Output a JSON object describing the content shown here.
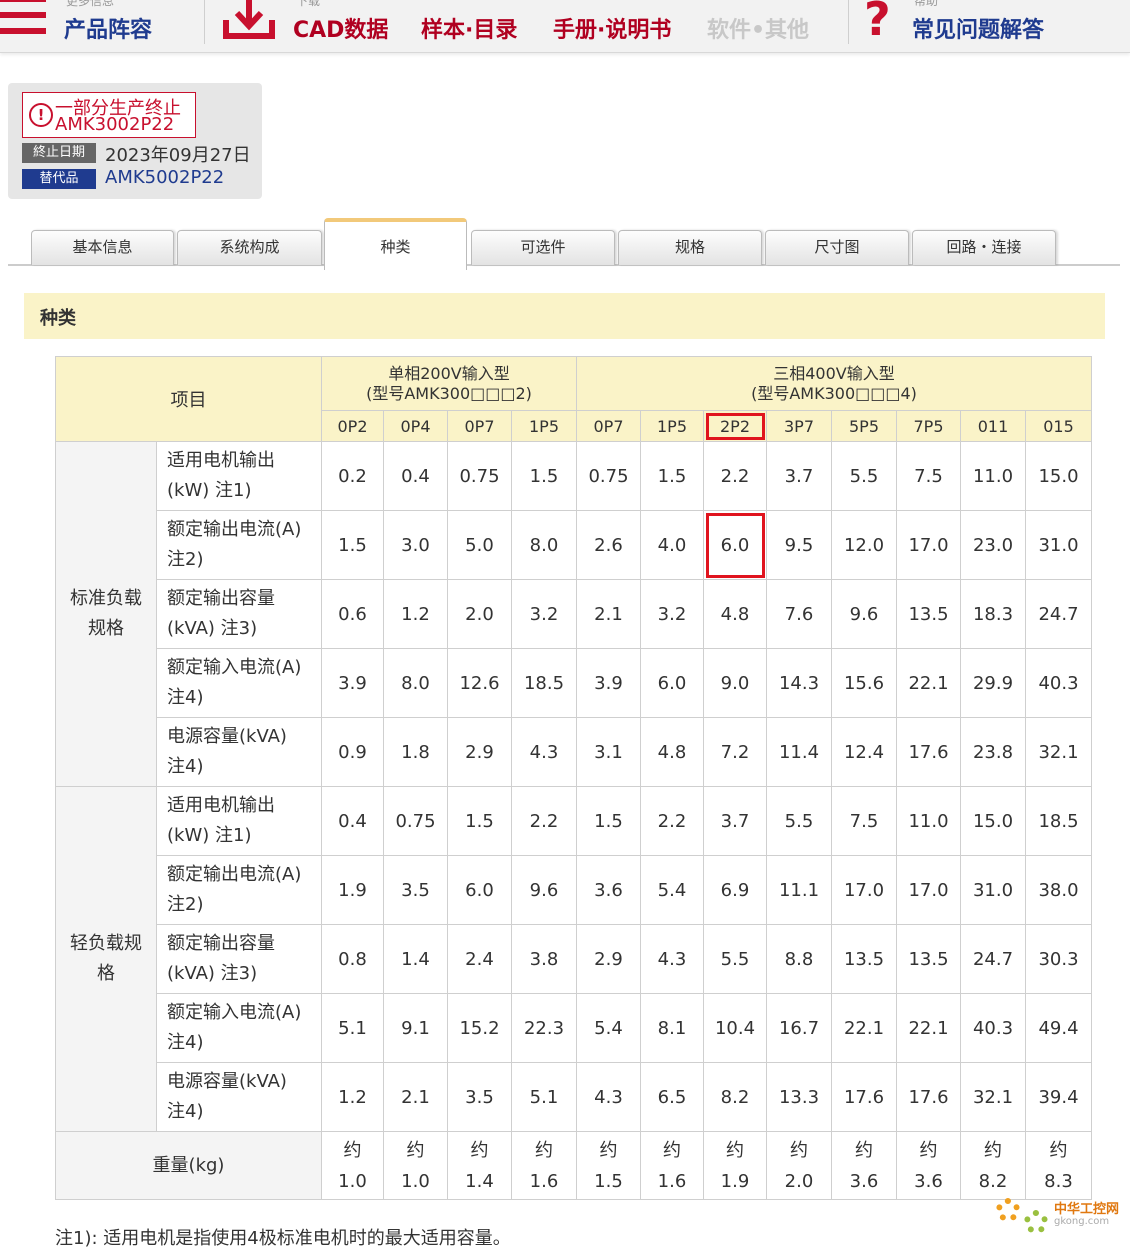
{
  "nav": {
    "small_1": "更多信息",
    "item_1": "产品阵容",
    "small_2": "下载",
    "item_2": "CAD数据",
    "item_3": "样本·目录",
    "item_4": "手册·说明书",
    "item_5": "软件•其他",
    "small_3": "帮助",
    "item_6": "常见问题解答",
    "accent_color": "#c8102e",
    "link_color": "#1f3b8f"
  },
  "status": {
    "title": "一部分生产终止",
    "model": "AMK3002P22",
    "end_label": "終止日期",
    "end_date": "2023年09月27日",
    "replacement_label": "替代品",
    "replacement": "AMK5002P22"
  },
  "tabs": [
    "基本信息",
    "系统构成",
    "种类",
    "可选件",
    "规格",
    "尺寸图",
    "回路・连接"
  ],
  "active_tab": "种类",
  "section_title": "种类",
  "table": {
    "item_header": "项目",
    "group_single_line1": "单相200V输入型",
    "group_single_line2": "(型号AMK300□□□2)",
    "group_three_line1": "三相400V输入型",
    "group_three_line2": "(型号AMK300□□□4)",
    "models": [
      "0P2",
      "0P4",
      "0P7",
      "1P5",
      "0P7",
      "1P5",
      "2P2",
      "3P7",
      "5P5",
      "7P5",
      "011",
      "015"
    ],
    "highlighted_model": "2P2",
    "sections": [
      {
        "name_line1": "标准负载",
        "name_line2": "规格",
        "rows": [
          {
            "label_line1": "适用电机输出",
            "label_line2": "(kW) 注1)",
            "values": [
              "0.2",
              "0.4",
              "0.75",
              "1.5",
              "0.75",
              "1.5",
              "2.2",
              "3.7",
              "5.5",
              "7.5",
              "11.0",
              "15.0"
            ]
          },
          {
            "label_line1": "额定输出电流(A)",
            "label_line2": "注2)",
            "values": [
              "1.5",
              "3.0",
              "5.0",
              "8.0",
              "2.6",
              "4.0",
              "6.0",
              "9.5",
              "12.0",
              "17.0",
              "23.0",
              "31.0"
            ]
          },
          {
            "label_line1": "额定输出容量",
            "label_line2": "(kVA) 注3)",
            "values": [
              "0.6",
              "1.2",
              "2.0",
              "3.2",
              "2.1",
              "3.2",
              "4.8",
              "7.6",
              "9.6",
              "13.5",
              "18.3",
              "24.7"
            ]
          },
          {
            "label_line1": "额定输入电流(A)",
            "label_line2": "注4)",
            "values": [
              "3.9",
              "8.0",
              "12.6",
              "18.5",
              "3.9",
              "6.0",
              "9.0",
              "14.3",
              "15.6",
              "22.1",
              "29.9",
              "40.3"
            ]
          },
          {
            "label_line1": "电源容量(kVA)",
            "label_line2": "注4)",
            "values": [
              "0.9",
              "1.8",
              "2.9",
              "4.3",
              "3.1",
              "4.8",
              "7.2",
              "11.4",
              "12.4",
              "17.6",
              "23.8",
              "32.1"
            ]
          }
        ]
      },
      {
        "name_line1": "轻负载规",
        "name_line2": "格",
        "rows": [
          {
            "label_line1": "适用电机输出",
            "label_line2": "(kW) 注1)",
            "values": [
              "0.4",
              "0.75",
              "1.5",
              "2.2",
              "1.5",
              "2.2",
              "3.7",
              "5.5",
              "7.5",
              "11.0",
              "15.0",
              "18.5"
            ]
          },
          {
            "label_line1": "额定输出电流(A)",
            "label_line2": "注2)",
            "values": [
              "1.9",
              "3.5",
              "6.0",
              "9.6",
              "3.6",
              "5.4",
              "6.9",
              "11.1",
              "17.0",
              "17.0",
              "31.0",
              "38.0"
            ]
          },
          {
            "label_line1": "额定输出容量",
            "label_line2": "(kVA) 注3)",
            "values": [
              "0.8",
              "1.4",
              "2.4",
              "3.8",
              "2.9",
              "4.3",
              "5.5",
              "8.8",
              "13.5",
              "13.5",
              "24.7",
              "30.3"
            ]
          },
          {
            "label_line1": "额定输入电流(A)",
            "label_line2": "注4)",
            "values": [
              "5.1",
              "9.1",
              "15.2",
              "22.3",
              "5.4",
              "8.1",
              "10.4",
              "16.7",
              "22.1",
              "22.1",
              "40.3",
              "49.4"
            ]
          },
          {
            "label_line1": "电源容量(kVA)",
            "label_line2": "注4)",
            "values": [
              "1.2",
              "2.1",
              "3.5",
              "5.1",
              "4.3",
              "6.5",
              "8.2",
              "13.3",
              "17.6",
              "17.6",
              "32.1",
              "39.4"
            ]
          }
        ]
      }
    ],
    "weight_label": "重量(kg)",
    "weight_prefix": "约",
    "weights": [
      "1.0",
      "1.0",
      "1.4",
      "1.6",
      "1.5",
      "1.6",
      "1.9",
      "2.0",
      "3.6",
      "3.6",
      "8.2",
      "8.3"
    ],
    "highlight_color": "#e0141e"
  },
  "note_1": "注1): 适用电机是指使用4极标准电机时的最大适用容量。",
  "watermark": {
    "text": "中华工控网",
    "url": "gkong.com"
  }
}
